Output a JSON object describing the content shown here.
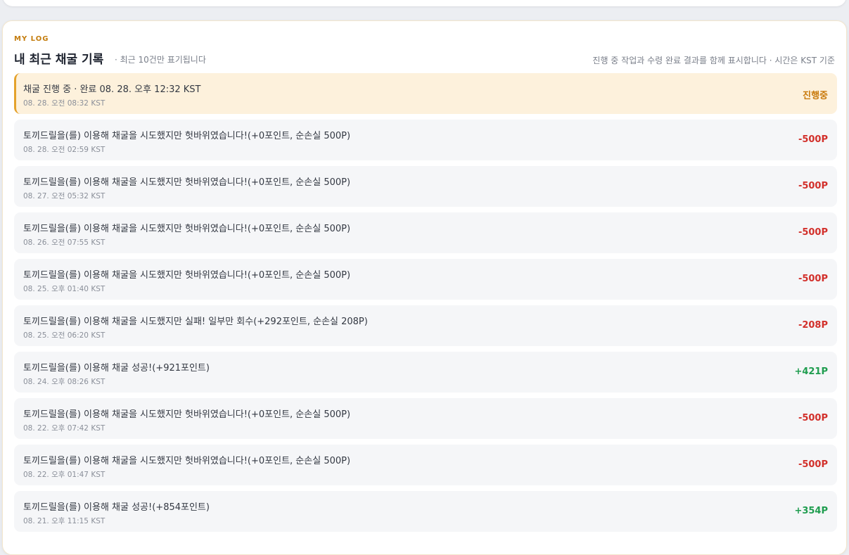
{
  "header": {
    "eyebrow": "MY LOG",
    "title": "내 최근 채굴 기록",
    "subtitle": "· 최근 10건만 표기됩니다",
    "note": "진행 중 작업과 수령 완료 결과를 함께 표시합니다 · 시간은 KST 기준"
  },
  "colors": {
    "negative": "#d2302b",
    "positive": "#1f9d4f",
    "pending": "#c97a0c"
  },
  "logs": [
    {
      "text": "채굴 진행 중 · 완료 08. 28. 오후 12:32 KST",
      "time": "08. 28. 오전 08:32 KST",
      "amount": "진행중",
      "status": "pending"
    },
    {
      "text": "토끼드릴을(를) 이용해 채굴을 시도했지만 헛바위였습니다!(+0포인트, 순손실 500P)",
      "time": "08. 28. 오전 02:59 KST",
      "amount": "-500P",
      "status": "negative"
    },
    {
      "text": "토끼드릴을(를) 이용해 채굴을 시도했지만 헛바위였습니다!(+0포인트, 순손실 500P)",
      "time": "08. 27. 오전 05:32 KST",
      "amount": "-500P",
      "status": "negative"
    },
    {
      "text": "토끼드릴을(를) 이용해 채굴을 시도했지만 헛바위였습니다!(+0포인트, 순손실 500P)",
      "time": "08. 26. 오전 07:55 KST",
      "amount": "-500P",
      "status": "negative"
    },
    {
      "text": "토끼드릴을(를) 이용해 채굴을 시도했지만 헛바위였습니다!(+0포인트, 순손실 500P)",
      "time": "08. 25. 오후 01:40 KST",
      "amount": "-500P",
      "status": "negative"
    },
    {
      "text": "토끼드릴을(를) 이용해 채굴을 시도했지만 실패! 일부만 회수(+292포인트, 순손실 208P)",
      "time": "08. 25. 오전 06:20 KST",
      "amount": "-208P",
      "status": "negative"
    },
    {
      "text": "토끼드릴을(를) 이용해 채굴 성공!(+921포인트)",
      "time": "08. 24. 오후 08:26 KST",
      "amount": "+421P",
      "status": "positive"
    },
    {
      "text": "토끼드릴을(를) 이용해 채굴을 시도했지만 헛바위였습니다!(+0포인트, 순손실 500P)",
      "time": "08. 22. 오후 07:42 KST",
      "amount": "-500P",
      "status": "negative"
    },
    {
      "text": "토끼드릴을(를) 이용해 채굴을 시도했지만 헛바위였습니다!(+0포인트, 순손실 500P)",
      "time": "08. 22. 오후 01:47 KST",
      "amount": "-500P",
      "status": "negative"
    },
    {
      "text": "토끼드릴을(를) 이용해 채굴 성공!(+854포인트)",
      "time": "08. 21. 오후 11:15 KST",
      "amount": "+354P",
      "status": "positive"
    }
  ]
}
